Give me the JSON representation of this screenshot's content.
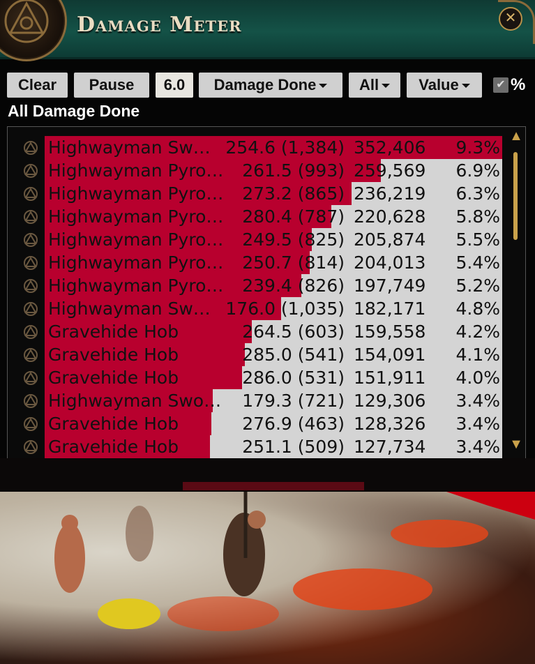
{
  "window": {
    "title": "Damage Meter",
    "close_icon": "close-icon"
  },
  "toolbar": {
    "clear_label": "Clear",
    "pause_label": "Pause",
    "interval_value": "6.0",
    "mode_label": "Damage Done",
    "filter_label": "All",
    "sort_label": "Value",
    "percent_label": "%",
    "percent_checked": true
  },
  "subtitle": "All Damage Done",
  "colors": {
    "bar_fill": "#b8002e",
    "bar_bg": "#d4d4d4",
    "accent_gold": "#c9a14a"
  },
  "rows": [
    {
      "name": "Highwayman Sw…",
      "dps": "254.6 (1,384)",
      "total": "352,406",
      "pct": "9.3%",
      "fill": 1.0
    },
    {
      "name": "Highwayman Pyro…",
      "dps": "261.5 (993)",
      "total": "259,569",
      "pct": "6.9%",
      "fill": 0.735
    },
    {
      "name": "Highwayman Pyro…",
      "dps": "273.2 (865)",
      "total": "236,219",
      "pct": "6.3%",
      "fill": 0.67
    },
    {
      "name": "Highwayman Pyro…",
      "dps": "280.4 (787)",
      "total": "220,628",
      "pct": "5.8%",
      "fill": 0.626
    },
    {
      "name": "Highwayman Pyro…",
      "dps": "249.5 (825)",
      "total": "205,874",
      "pct": "5.5%",
      "fill": 0.584
    },
    {
      "name": "Highwayman Pyro…",
      "dps": "250.7 (814)",
      "total": "204,013",
      "pct": "5.4%",
      "fill": 0.579
    },
    {
      "name": "Highwayman Pyro…",
      "dps": "239.4 (826)",
      "total": "197,749",
      "pct": "5.2%",
      "fill": 0.561
    },
    {
      "name": "Highwayman Sw…",
      "dps": "176.0 (1,035)",
      "total": "182,171",
      "pct": "4.8%",
      "fill": 0.517
    },
    {
      "name": "Gravehide Hob",
      "dps": "264.5 (603)",
      "total": "159,558",
      "pct": "4.2%",
      "fill": 0.453
    },
    {
      "name": "Gravehide Hob",
      "dps": "285.0 (541)",
      "total": "154,091",
      "pct": "4.1%",
      "fill": 0.437
    },
    {
      "name": "Gravehide Hob",
      "dps": "286.0 (531)",
      "total": "151,911",
      "pct": "4.0%",
      "fill": 0.431
    },
    {
      "name": "Highwayman Swor…",
      "dps": "179.3 (721)",
      "total": "129,306",
      "pct": "3.4%",
      "fill": 0.367
    },
    {
      "name": "Gravehide Hob",
      "dps": "276.9 (463)",
      "total": "128,326",
      "pct": "3.4%",
      "fill": 0.364
    },
    {
      "name": "Gravehide Hob",
      "dps": "251.1 (509)",
      "total": "127,734",
      "pct": "3.4%",
      "fill": 0.362
    }
  ]
}
